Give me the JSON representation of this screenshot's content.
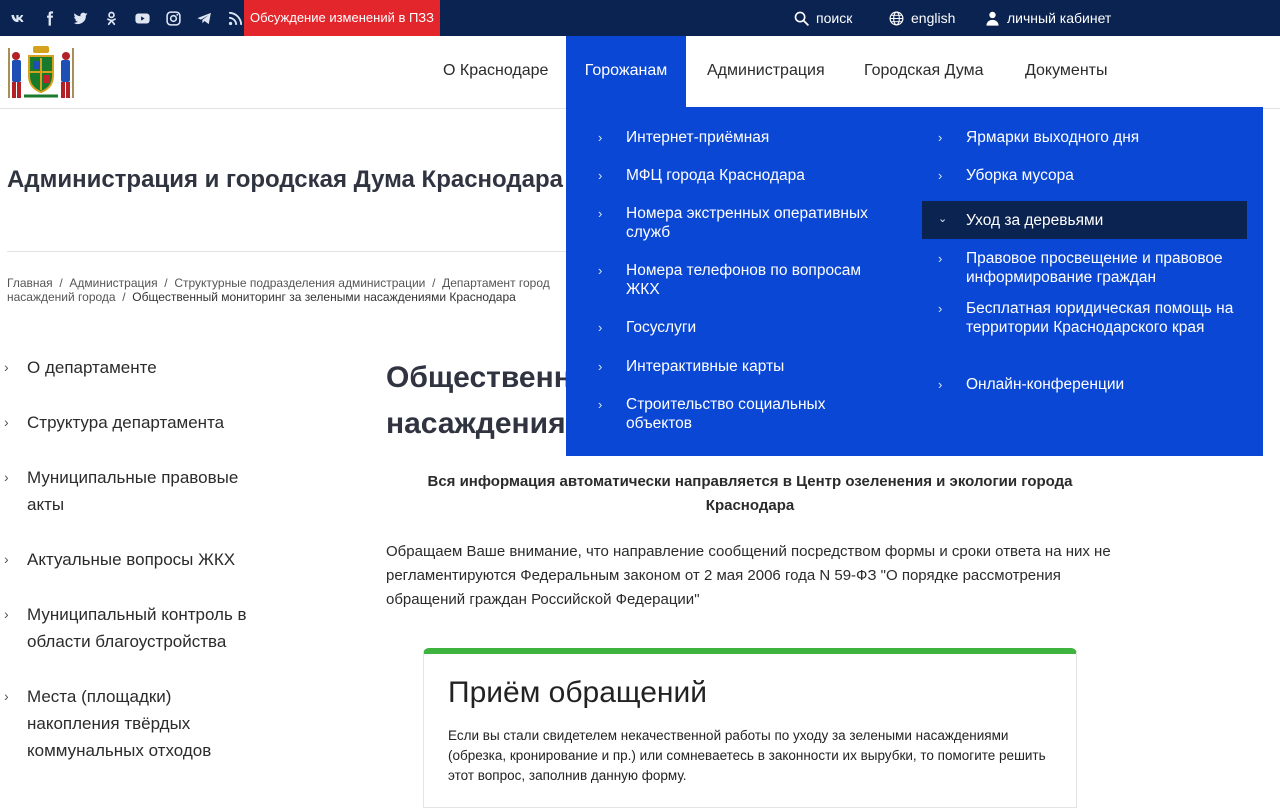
{
  "topbar": {
    "social": [
      "vk-icon",
      "facebook-icon",
      "twitter-icon",
      "odnoklassniki-icon",
      "youtube-icon",
      "instagram-icon",
      "telegram-icon",
      "rss-icon"
    ],
    "promo": "Обсуждение изменений в ПЗЗ",
    "search": "поиск",
    "english": "english",
    "cabinet": "личный кабинет"
  },
  "nav": {
    "items": [
      "О Краснодаре",
      "Горожанам",
      "Администрация",
      "Городская Дума",
      "Документы"
    ]
  },
  "dropdown": {
    "left": [
      "Интернет-приёмная",
      "МФЦ города Краснодара",
      "Номера экстренных оперативных служб",
      "Номера телефонов по вопросам ЖКХ",
      "Госуслуги",
      "Интерактивные карты",
      "Строительство социальных объектов"
    ],
    "right": [
      "Ярмарки выходного дня",
      "Уборка мусора",
      "Уход за деревьями",
      "Правовое просвещение и правовое информирование граждан",
      "Бесплатная юридическая помощь на территории Краснодарского края",
      "Онлайн-конференции"
    ]
  },
  "page_title": "Администрация и городская Дума Краснодара",
  "breadcrumbs": [
    "Главная",
    "Администрация",
    "Структурные подразделения администрации",
    "Департамент городского хозяйства и топливно-энергетического комплекса",
    "зеленых насаждений города",
    "Общественный мониторинг за зелеными насаждениями Краснодара"
  ],
  "breadcrumb_line1": [
    "Главная",
    "Администрация",
    "Структурные подразделения администрации",
    "Департамент город"
  ],
  "breadcrumb_line2": [
    "насаждений города",
    "Общественный мониторинг за зелеными насаждениями Краснодара"
  ],
  "sidebar": [
    "О департаменте",
    "Структура департамента",
    "Муниципальные правовые акты",
    "Актуальные вопросы ЖКХ",
    "Муниципальный контроль в области благоустройства",
    "Места (площадки) накопления твёрдых коммунальных отходов"
  ],
  "content": {
    "title_line1": "Общественн",
    "title_line2": "насаждения",
    "lead": "Вся информация автоматически направляется в Центр озеленения и экологии города Краснодара",
    "paragraph": "Обращаем Ваше внимание, что направление сообщений посредством формы и сроки ответа на них не регламентируются Федеральным законом от 2 мая 2006 года N 59-ФЗ \"О порядке рассмотрения обращений граждан Российской Федерации\"",
    "card_title": "Приём обращений",
    "card_text": "Если вы стали свидетелем некачественной работы по уходу за зелеными насаждениями (обрезка, кронирование и пр.) или сомневаетесь в законности их вырубки, то помогите решить этот вопрос, заполнив данную форму."
  }
}
